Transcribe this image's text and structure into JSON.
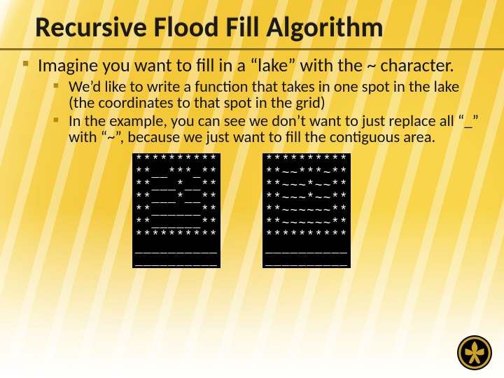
{
  "title": "Recursive Flood Fill Algorithm",
  "bullets": {
    "top": "Imagine you want to fill in a “lake” with the ~ character.",
    "sub1": "We’d like to write a function that takes in one spot in the lake (the coordinates to that spot in the grid)",
    "sub2": "In the example, you can see we don’t want to just replace all “_” with “~”, because we just want to fill the contiguous area."
  },
  "grids": {
    "before": "**********\n**__***_**\n**___*__**\n**___*__**\n**______**\n**______**\n**********\n__________\n__________",
    "after": "**********\n**~~***~**\n**~~~*~~**\n**~~~*~~**\n**~~~~~~**\n**~~~~~~**\n**********\n__________\n__________"
  },
  "logo_alt": "UCF Pegasus logo"
}
